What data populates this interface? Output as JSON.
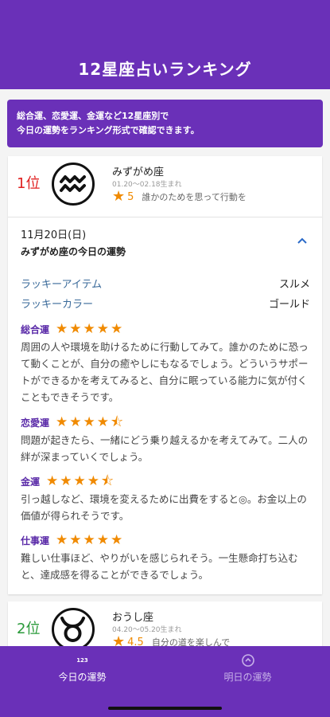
{
  "header": {
    "title": "12星座占いランキング"
  },
  "notice": {
    "line1": "総合運、恋愛運、金運など12星座別で",
    "line2": "今日の運勢をランキング形式で確認できます。"
  },
  "rankings": [
    {
      "rank": "1位",
      "sign_icon": "aquarius-icon",
      "name": "みずがめ座",
      "dates": "01.20〜02.18生まれ",
      "score": "5",
      "summary": "誰かのためを思って行動を",
      "detail": {
        "date": "11月20日(日)",
        "title": "みずがめ座の今日の運勢",
        "lucky_item_label": "ラッキーアイテム",
        "lucky_item": "スルメ",
        "lucky_color_label": "ラッキーカラー",
        "lucky_color": "ゴールド",
        "fortunes": [
          {
            "label": "総合運",
            "stars": "★★★★★",
            "rating": 5,
            "text": "周囲の人や環境を助けるために行動してみて。誰かのために恐って動くことが、自分の癒やしにもなるでしょう。どういうサポートができるかを考えてみると、自分に眠っている能力に気が付くこともできそうです。"
          },
          {
            "label": "恋愛運",
            "stars": "★★★★⯪",
            "rating": 4.5,
            "text": "問題が起きたら、一緒にどう乗り越えるかを考えてみて。二人の絆が深まっていくでしょう。"
          },
          {
            "label": "金運",
            "stars": "★★★★⯪",
            "rating": 4.5,
            "text": "引っ越しなど、環境を変えるために出費をすると◎。お金以上の価値が得られそうです。"
          },
          {
            "label": "仕事運",
            "stars": "★★★★★",
            "rating": 5,
            "text": "難しい仕事ほど、やりがいを感じられそう。一生懸命打ち込むと、達成感を得ることができるでしょう。"
          }
        ]
      }
    },
    {
      "rank": "2位",
      "sign_icon": "taurus-icon",
      "name": "おうし座",
      "dates": "04.20〜05.20生まれ",
      "score": "4.5",
      "summary": "自分の道を楽しんで"
    }
  ],
  "bottom_nav": [
    {
      "icon_text": "123",
      "label": "今日の運勢",
      "active": true
    },
    {
      "icon": "clock-icon",
      "label": "明日の運勢",
      "active": false
    }
  ],
  "colors": {
    "primary": "#6a30b8",
    "star": "#f08a00",
    "rank1": "#e02020",
    "rank2": "#2a9a3a",
    "lucky_label": "#3a6a9a"
  }
}
